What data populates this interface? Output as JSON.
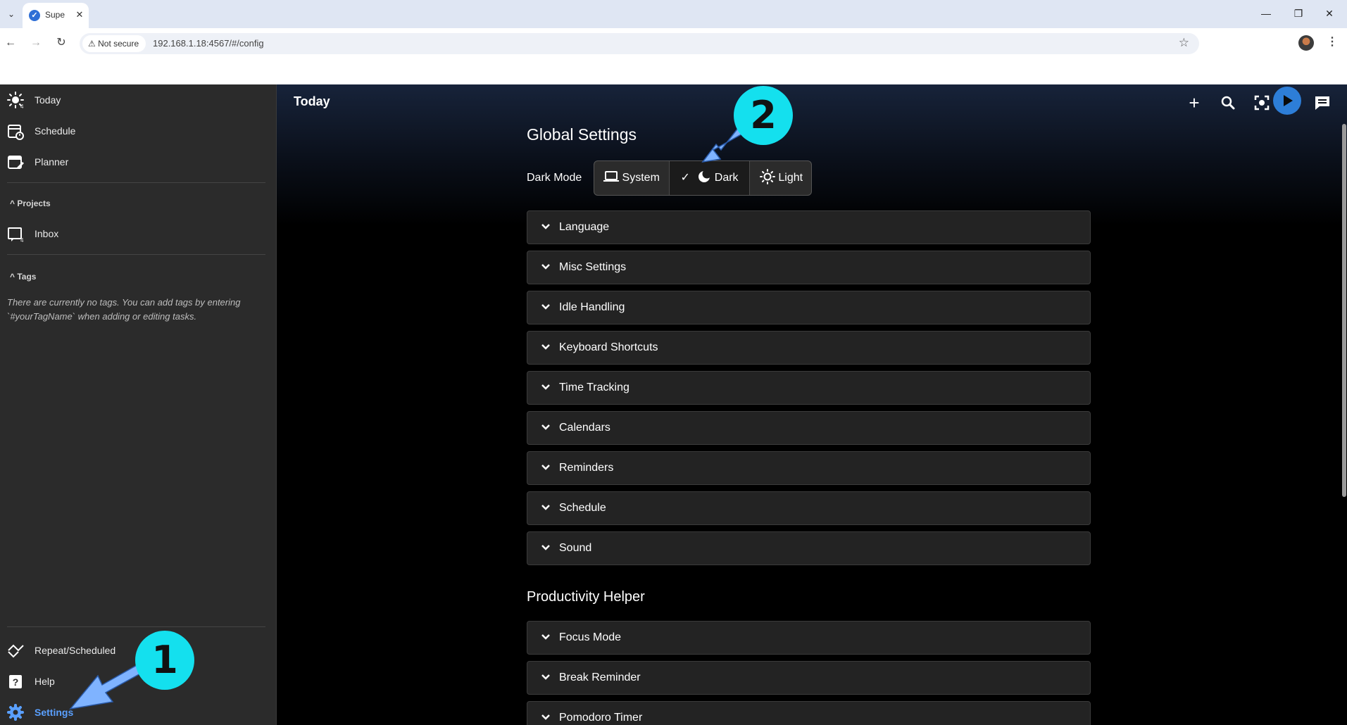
{
  "browser": {
    "tab_title": "Supe",
    "tab_close": "✕",
    "not_secure": "Not secure",
    "url": "192.168.1.18:4567/#/config",
    "window_controls": {
      "minimize": "—",
      "restore": "❐",
      "close": "✕"
    }
  },
  "sidebar": {
    "items": [
      {
        "label": "Today",
        "badge": "4",
        "icon": "sun-icon"
      },
      {
        "label": "Schedule",
        "icon": "calendar-clock-icon"
      },
      {
        "label": "Planner",
        "icon": "calendar-edit-icon"
      }
    ],
    "projects_title": "Projects",
    "projects": [
      {
        "label": "Inbox",
        "badge": "4",
        "icon": "inbox-icon"
      }
    ],
    "tags_title": "Tags",
    "tags_note": "There are currently no tags. You can add tags by entering `#yourTagName` when adding or editing tasks.",
    "bottom": [
      {
        "label": "Repeat/Scheduled",
        "icon": "repeat-icon"
      },
      {
        "label": "Help",
        "icon": "help-icon"
      },
      {
        "label": "Settings",
        "icon": "gear-icon",
        "active": true
      }
    ]
  },
  "main": {
    "title": "Today",
    "global_settings": "Global Settings",
    "dark_mode_label": "Dark Mode",
    "dark_mode_options": [
      "System",
      "Dark",
      "Light"
    ],
    "dark_mode_selected": "Dark",
    "sections": [
      "Language",
      "Misc Settings",
      "Idle Handling",
      "Keyboard Shortcuts",
      "Time Tracking",
      "Calendars",
      "Reminders",
      "Schedule",
      "Sound"
    ],
    "productivity_helper": "Productivity Helper",
    "productivity_sections": [
      "Focus Mode",
      "Break Reminder",
      "Pomodoro Timer"
    ]
  },
  "annotations": {
    "step1": "1",
    "step2": "2"
  },
  "colors": {
    "accent": "#2d7ed8",
    "annotation_badge": "#14e0ee",
    "annotation_arrow": "#7fb3ff",
    "settings_active": "#5aa0ff"
  }
}
